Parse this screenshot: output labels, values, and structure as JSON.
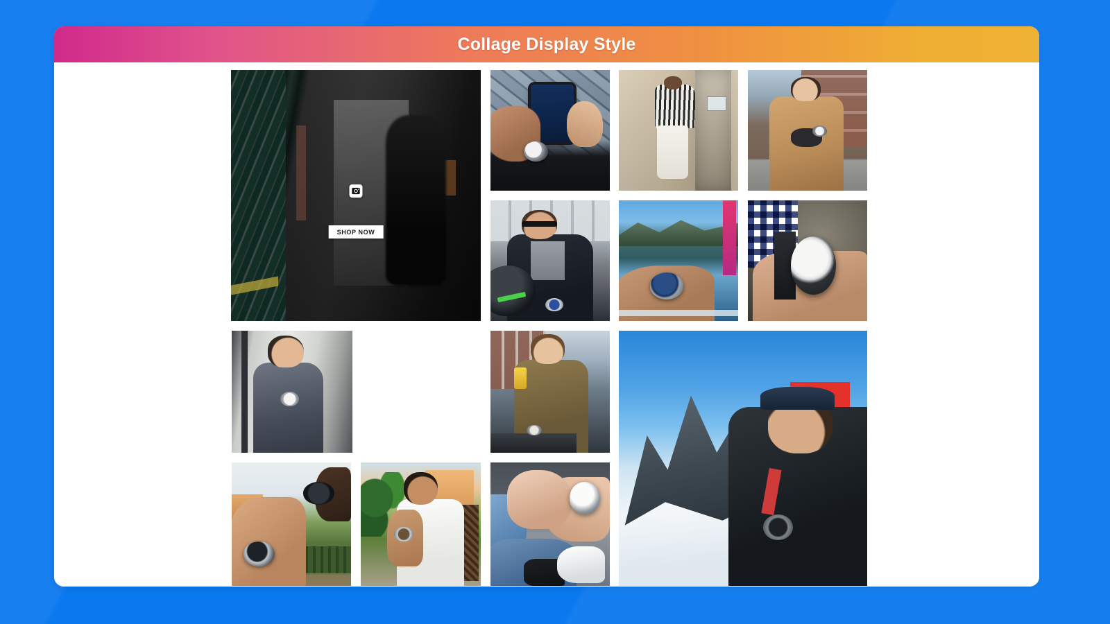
{
  "page": {
    "background_color": "#0a78ef"
  },
  "card": {
    "header": {
      "title": "Collage Display Style",
      "gradient_start": "#d02a8b",
      "gradient_mid": "#ee7a5a",
      "gradient_end": "#efb133"
    }
  },
  "collage": {
    "overlay": {
      "instagram_icon_name": "instagram-camera-icon",
      "shop_now_label": "SHOP NOW"
    },
    "tiles": [
      {
        "id": "tile-1",
        "alt": "Man in dark gallery corridor with striped mural",
        "theme": "gallery"
      },
      {
        "id": "tile-2",
        "alt": "Hands holding smartphone, wrist watch visible, glass pavement",
        "theme": "phone"
      },
      {
        "id": "tile-3",
        "alt": "Man in striped shirt and white jeans against concrete wall",
        "theme": "stripes"
      },
      {
        "id": "tile-4",
        "alt": "Man in camel overcoat and gloves checking watch on street",
        "theme": "coat"
      },
      {
        "id": "tile-5",
        "alt": "Man with sunglasses leaning on scooter helmet",
        "theme": "scooter"
      },
      {
        "id": "tile-6",
        "alt": "Blue dial watch on wrist with alpine lake backdrop",
        "theme": "lake"
      },
      {
        "id": "tile-7",
        "alt": "Chronograph watch with blue checkered shirt cuff",
        "theme": "check"
      },
      {
        "id": "tile-8",
        "alt": "Man in grey jacket beside glass wall adjusting watch",
        "theme": "glass"
      },
      {
        "id": "tile-9",
        "alt": "Man drinking beer at canal side cafe wearing watch",
        "theme": "canal"
      },
      {
        "id": "tile-10",
        "alt": "Man in snowy alps with Swiss flag wearing watch",
        "theme": "alps"
      },
      {
        "id": "tile-11",
        "alt": "Hand with sunglasses and steel watch, villa garden",
        "theme": "villa"
      },
      {
        "id": "tile-12",
        "alt": "Man in white tee seated outdoors near palms wearing watch",
        "theme": "palm"
      },
      {
        "id": "tile-13",
        "alt": "Close up of white dial watch over denim and sneakers",
        "theme": "denim"
      }
    ]
  }
}
